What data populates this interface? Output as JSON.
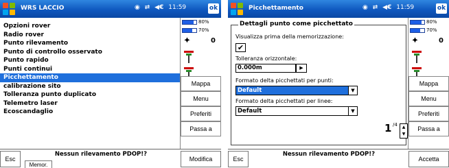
{
  "screen1": {
    "title": "WRS LACCIO",
    "time": "11:59",
    "ok_label": "ok",
    "menu_items": [
      {
        "label": "Opzioni rover",
        "selected": false
      },
      {
        "label": "Radio rover",
        "selected": false
      },
      {
        "label": "Punto rilevamento",
        "selected": false
      },
      {
        "label": "Punto di controllo osservato",
        "selected": false
      },
      {
        "label": "Punto rapido",
        "selected": false
      },
      {
        "label": "Punti continui",
        "selected": false
      },
      {
        "label": "Picchettamento",
        "selected": true
      },
      {
        "label": "calibrazione sito",
        "selected": false
      },
      {
        "label": "Tolleranza punto duplicato",
        "selected": false
      },
      {
        "label": "Telemetro laser",
        "selected": false
      },
      {
        "label": "Ecoscandaglio",
        "selected": false
      }
    ],
    "status_text": "Nessun rilevamento PDOP!?",
    "esc_label": "Esc",
    "memor_label": "Memor.",
    "modifica_label": "Modifica"
  },
  "screen2": {
    "title": "Picchettamento",
    "time": "11:59",
    "ok_label": "ok",
    "group_title": "Dettagli punto come picchettato",
    "show_before_save_label": "Visualizza prima della memorizzazione:",
    "show_before_save_checked": true,
    "checkbox_mark": "✔",
    "horiz_tol_label": "Tolleranza orizzontale:",
    "horiz_tol_value": "0.000m",
    "points_format_label": "Formato delta picchettati per punti:",
    "points_format_value": "Default",
    "lines_format_label": "Formato delta picchettati per linee:",
    "lines_format_value": "Default",
    "page_current": "1",
    "page_total": "/4",
    "status_text": "Nessun rilevamento PDOP!?",
    "esc_label": "Esc",
    "accetta_label": "Accetta"
  },
  "side": {
    "batt1_label": "80%",
    "batt1_fraction": 0.8,
    "batt2_label": "70%",
    "batt2_fraction": 0.7,
    "sat_count": "0",
    "question_mark": "?",
    "buttons": [
      "Mappa",
      "Menu",
      "Preferiti",
      "Passa a"
    ]
  },
  "system": {
    "gps_icon": "◉",
    "sync_icon": "⇄",
    "volume_icon": "◀€"
  },
  "colors": {
    "titlebar": "#0f58bf",
    "selection": "#1f6fdc",
    "battery": "#1e5fe6"
  }
}
